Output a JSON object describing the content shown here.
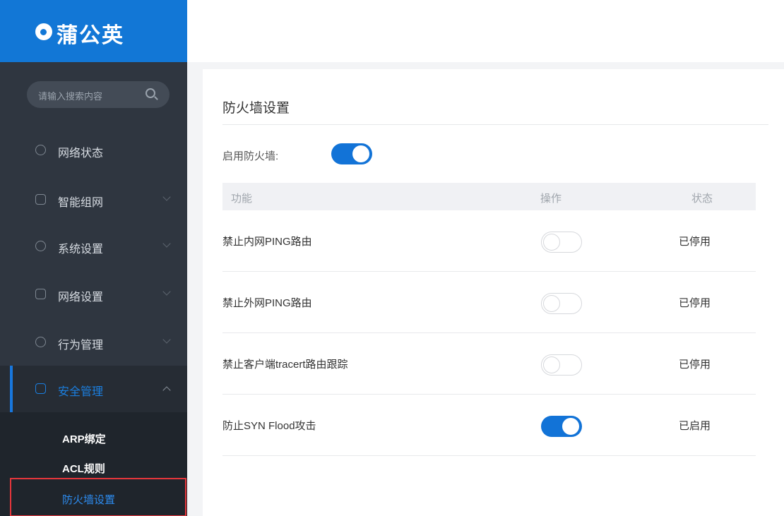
{
  "brand": {
    "name": "蒲公英"
  },
  "search": {
    "placeholder": "请输入搜索内容"
  },
  "nav": {
    "items": [
      {
        "label": "网络状态",
        "icon": "network-status-icon"
      },
      {
        "label": "智能组网",
        "icon": "smart-network-icon"
      },
      {
        "label": "系统设置",
        "icon": "system-settings-icon"
      },
      {
        "label": "网络设置",
        "icon": "network-settings-icon"
      },
      {
        "label": "行为管理",
        "icon": "behavior-management-icon"
      },
      {
        "label": "安全管理",
        "icon": "security-icon"
      }
    ],
    "submenu": [
      "ARP绑定",
      "ACL规则",
      "防火墙设置"
    ]
  },
  "page": {
    "title": "防火墙设置",
    "enable_label": "启用防火墙:",
    "enable_state": "on"
  },
  "table": {
    "headers": [
      "功能",
      "操作",
      "状态"
    ],
    "rows": [
      {
        "feature": "禁止内网PING路由",
        "toggle": "off",
        "status": "已停用"
      },
      {
        "feature": "禁止外网PING路由",
        "toggle": "off",
        "status": "已停用"
      },
      {
        "feature": "禁止客户端tracert路由跟踪",
        "toggle": "off",
        "status": "已停用"
      },
      {
        "feature": "防止SYN Flood攻击",
        "toggle": "on",
        "status": "已启用"
      }
    ]
  },
  "colors": {
    "brand_blue": "#1277d6",
    "sidebar_bg": "#2f3640",
    "toggle_on": "#1273d7",
    "highlight_border": "#e5363b"
  }
}
